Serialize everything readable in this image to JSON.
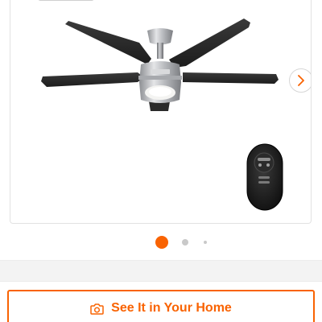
{
  "product_gallery": {
    "main_image_alt": "ceiling-fan-with-light-and-remote",
    "next_icon": "chevron-right-icon",
    "carousel": {
      "total_indicators": 3,
      "active_index": 1
    }
  },
  "actions": {
    "see_in_home_label": "See It in Your Home",
    "see_in_home_icon": "camera-icon"
  },
  "colors": {
    "accent": "#f96302",
    "indicator_inactive": "#c9c9c9",
    "border": "#e2e2e2"
  }
}
